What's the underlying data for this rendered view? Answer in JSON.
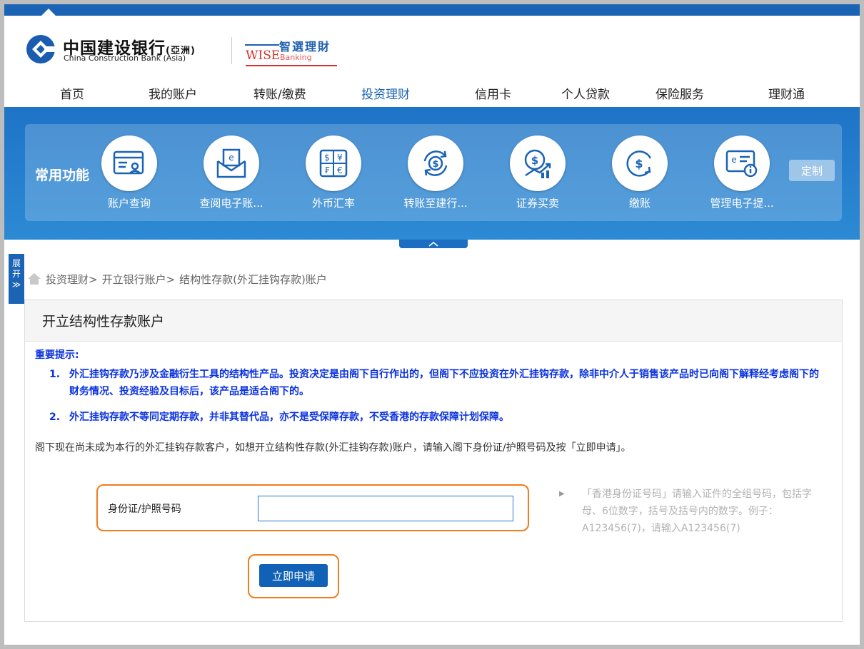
{
  "brand": {
    "bank_name_cn": "中国建设银行",
    "bank_name_suffix": "(亞洲)",
    "bank_name_en": "China Construction Bank (Asia)",
    "wise_cn": "智選理財",
    "wise_en": "WISE",
    "wise_banking": "Banking",
    "primary_color": "#1a63b5",
    "accent_color": "#d8302b"
  },
  "nav": {
    "items": [
      {
        "label": "首页"
      },
      {
        "label": "我的账户"
      },
      {
        "label": "转账/缴费"
      },
      {
        "label": "投资理财"
      },
      {
        "label": "信用卡"
      },
      {
        "label": "个人贷款"
      },
      {
        "label": "保险服务"
      },
      {
        "label": "理财通"
      }
    ],
    "active": "投资理财"
  },
  "quick_functions": {
    "title": "常用功能",
    "items": [
      {
        "label": "账户查询",
        "icon": "account-inquiry-icon"
      },
      {
        "label": "查阅电子账...",
        "icon": "e-statement-icon"
      },
      {
        "label": "外币汇率",
        "icon": "exchange-rate-icon"
      },
      {
        "label": "转账至建行...",
        "icon": "transfer-icon"
      },
      {
        "label": "证券买卖",
        "icon": "securities-icon"
      },
      {
        "label": "缴账",
        "icon": "bill-payment-icon"
      },
      {
        "label": "管理电子提...",
        "icon": "e-notice-icon"
      }
    ],
    "customize_label": "定制"
  },
  "side_tab": {
    "label_1": "展",
    "label_2": "开",
    "label_3": "≫"
  },
  "breadcrumb": {
    "items": [
      "投资理财>",
      "开立银行账户>",
      "结构性存款(外汇挂钩存款)账户"
    ]
  },
  "page": {
    "title": "开立结构性存款账户",
    "notice_title": "重要提示:",
    "notices": [
      {
        "num": "1.",
        "text": "外汇挂钩存款乃涉及金融衍生工具的结构性产品。投资决定是由阁下自行作出的，但阁下不应投资在外汇挂钩存款，除非中介人于销售该产品时已向阁下解释经考虑阁下的财务情况、投资经验及目标后，该产品是适合阁下的。"
      },
      {
        "num": "2.",
        "text": "外汇挂钩存款不等同定期存款，并非其替代品，亦不是受保障存款，不受香港的存款保障计划保障。"
      }
    ],
    "intro": "阁下现在尚未成为本行的外汇挂钩存款客户，如想开立结构性存款(外汇挂钩存款)账户，请输入阁下身份证/护照号码及按「立即申请」。",
    "form": {
      "id_label": "身份证/护照号码",
      "id_value": "",
      "hint": "「香港身份证号码」请输入证件的全组号码，包括字母、6位数字，括号及括号内的数字。例子：A123456(7)，请输入A123456(7)",
      "submit_label": "立即申请"
    }
  }
}
